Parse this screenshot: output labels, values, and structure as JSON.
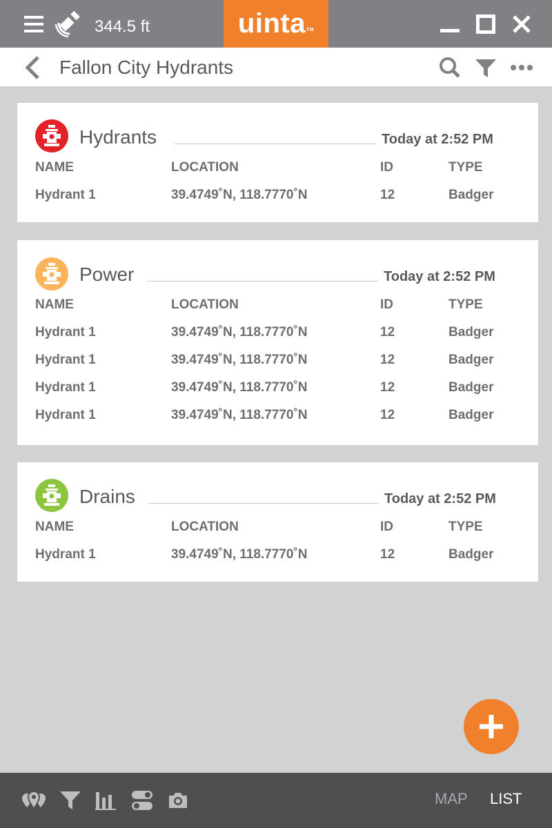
{
  "topbar": {
    "distance": "344.5 ft",
    "logo_text": "uinta",
    "logo_tm": "TM"
  },
  "header": {
    "title": "Fallon City Hydrants"
  },
  "columns": {
    "name": "NAME",
    "location": "LOCATION",
    "id": "ID",
    "type": "TYPE"
  },
  "cards": [
    {
      "title": "Hydrants",
      "time": "Today at 2:52 PM",
      "icon_color": "#e42126",
      "rows": [
        {
          "name": "Hydrant 1",
          "location": "39.4749˚N, 118.7770˚N",
          "id": "12",
          "type": "Badger"
        }
      ]
    },
    {
      "title": "Power",
      "time": "Today at 2:52 PM",
      "icon_color": "#fdb35a",
      "rows": [
        {
          "name": "Hydrant 1",
          "location": "39.4749˚N, 118.7770˚N",
          "id": "12",
          "type": "Badger"
        },
        {
          "name": "Hydrant 1",
          "location": "39.4749˚N, 118.7770˚N",
          "id": "12",
          "type": "Badger"
        },
        {
          "name": "Hydrant 1",
          "location": "39.4749˚N, 118.7770˚N",
          "id": "12",
          "type": "Badger"
        },
        {
          "name": "Hydrant 1",
          "location": "39.4749˚N, 118.7770˚N",
          "id": "12",
          "type": "Badger"
        }
      ]
    },
    {
      "title": "Drains",
      "time": "Today at 2:52 PM",
      "icon_color": "#8cc63f",
      "rows": [
        {
          "name": "Hydrant 1",
          "location": "39.4749˚N, 118.7770˚N",
          "id": "12",
          "type": "Badger"
        }
      ]
    }
  ],
  "bottombar": {
    "tabs": [
      {
        "label": "MAP",
        "active": false
      },
      {
        "label": "LIST",
        "active": true
      }
    ]
  },
  "icons": {
    "menu": "menu-icon",
    "gps": "gps-satellite-icon",
    "minimize": "minimize-icon",
    "maximize": "maximize-icon",
    "close": "close-icon",
    "back": "chevron-left-icon",
    "search": "search-icon",
    "filter": "filter-icon",
    "more": "more-dots-icon",
    "hydrant": "hydrant-icon",
    "add": "plus-icon",
    "map_pins": "map-pins-icon",
    "bar_chart": "bar-chart-icon",
    "toggles": "toggle-switch-icon",
    "camera": "camera-icon"
  },
  "colors": {
    "accent": "#f0802b",
    "topbar": "#808184",
    "bottombar": "#4f4f51",
    "background": "#d1d2d4"
  }
}
